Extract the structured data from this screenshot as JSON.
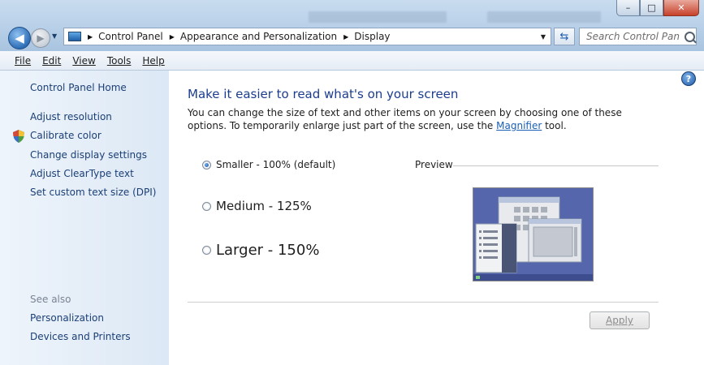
{
  "window": {
    "minimize": "–",
    "maximize": "□",
    "close": "✕"
  },
  "nav": {
    "back_glyph": "◀",
    "forward_glyph": "▶",
    "history_glyph": "▼"
  },
  "address": {
    "crumbs": [
      "Control Panel",
      "Appearance and Personalization",
      "Display"
    ],
    "separator_glyph": "▶",
    "dropdown_glyph": "▼"
  },
  "refresh_glyph": "⇆",
  "search": {
    "placeholder": "Search Control Panel"
  },
  "menu": [
    "File",
    "Edit",
    "View",
    "Tools",
    "Help"
  ],
  "sidebar": {
    "home": "Control Panel Home",
    "links": [
      "Adjust resolution",
      "Calibrate color",
      "Change display settings",
      "Adjust ClearType text",
      "Set custom text size (DPI)"
    ],
    "see_also": "See also",
    "see_also_links": [
      "Personalization",
      "Devices and Printers"
    ]
  },
  "main": {
    "help_glyph": "?",
    "heading": "Make it easier to read what's on your screen",
    "desc_pre": "You can change the size of text and other items on your screen by choosing one of these options. To temporarily enlarge just part of the screen, use the ",
    "desc_link": "Magnifier",
    "desc_post": " tool.",
    "options": [
      {
        "label": "Smaller - 100% (default)",
        "selected": true
      },
      {
        "label": "Medium - 125%",
        "selected": false
      },
      {
        "label": "Larger - 150%",
        "selected": false
      }
    ],
    "preview_label": "Preview",
    "apply": "Apply"
  },
  "colors": {
    "heading": "#1b3d8f",
    "link": "#1b3f75",
    "preview_desktop": "#4f60a8"
  }
}
